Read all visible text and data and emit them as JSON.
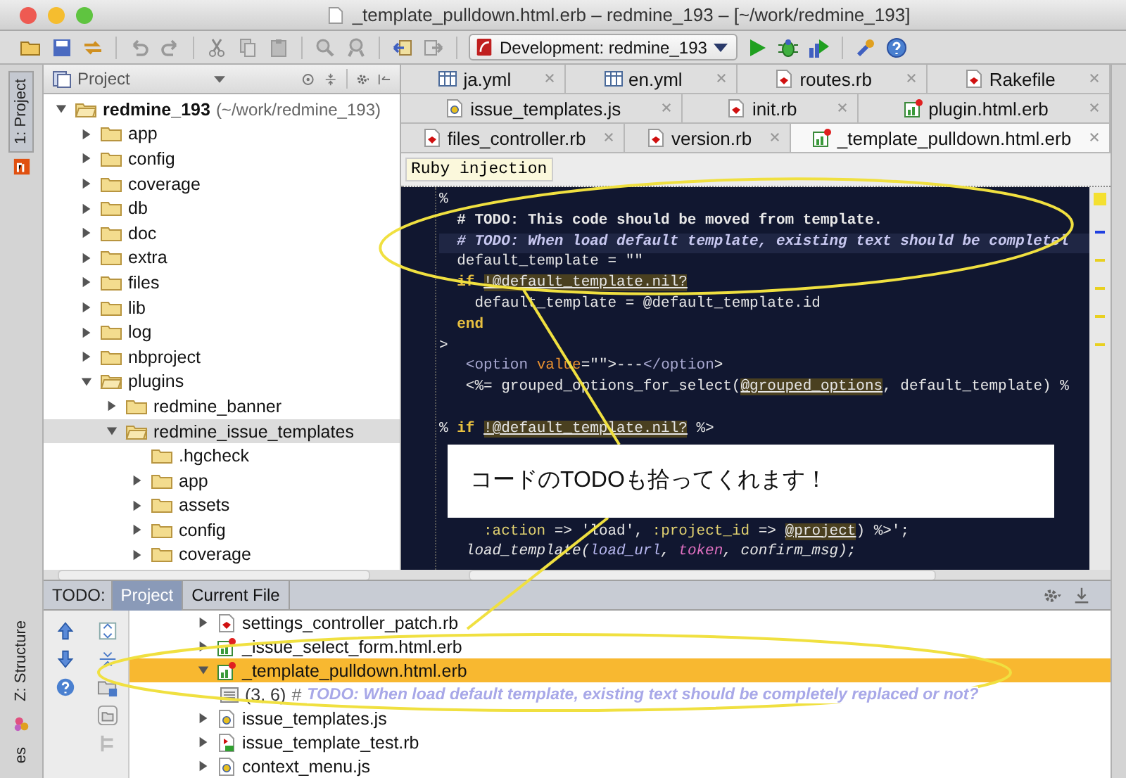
{
  "window": {
    "title": "_template_pulldown.html.erb – redmine_193 – [~/work/redmine_193]"
  },
  "toolbar": {
    "run_config": "Development: redmine_193"
  },
  "tool_strip": {
    "top_tabs": [
      {
        "label": "1: Project",
        "selected": true
      }
    ],
    "bottom_tabs": [
      {
        "label": "Z: Structure",
        "selected": false
      },
      {
        "label": "es",
        "selected": false
      }
    ]
  },
  "project_panel": {
    "title": "Project",
    "tree": [
      {
        "name": "redmine_193",
        "hint": "(~/work/redmine_193)",
        "expandable": true,
        "expanded": true,
        "selected": false,
        "children": [
          {
            "name": "app",
            "expandable": true,
            "expanded": false,
            "selected": false
          },
          {
            "name": "config",
            "expandable": true,
            "expanded": false,
            "selected": false
          },
          {
            "name": "coverage",
            "expandable": true,
            "expanded": false,
            "selected": false
          },
          {
            "name": "db",
            "expandable": true,
            "expanded": false,
            "selected": false
          },
          {
            "name": "doc",
            "expandable": true,
            "expanded": false,
            "selected": false
          },
          {
            "name": "extra",
            "expandable": true,
            "expanded": false,
            "selected": false
          },
          {
            "name": "files",
            "expandable": true,
            "expanded": false,
            "selected": false
          },
          {
            "name": "lib",
            "expandable": true,
            "expanded": false,
            "selected": false
          },
          {
            "name": "log",
            "expandable": true,
            "expanded": false,
            "selected": false
          },
          {
            "name": "nbproject",
            "expandable": true,
            "expanded": false,
            "selected": false
          },
          {
            "name": "plugins",
            "expandable": true,
            "expanded": true,
            "selected": false,
            "children": [
              {
                "name": "redmine_banner",
                "expandable": true,
                "expanded": false,
                "selected": false
              },
              {
                "name": "redmine_issue_templates",
                "expandable": true,
                "expanded": true,
                "selected": true,
                "children": [
                  {
                    "name": ".hgcheck",
                    "expandable": false,
                    "expanded": false,
                    "selected": false
                  },
                  {
                    "name": "app",
                    "expandable": true,
                    "expanded": false,
                    "selected": false
                  },
                  {
                    "name": "assets",
                    "expandable": true,
                    "expanded": false,
                    "selected": false
                  },
                  {
                    "name": "config",
                    "expandable": true,
                    "expanded": false,
                    "selected": false
                  },
                  {
                    "name": "coverage",
                    "expandable": true,
                    "expanded": false,
                    "selected": false
                  }
                ]
              }
            ]
          }
        ]
      }
    ]
  },
  "editor": {
    "tab_rows": [
      [
        {
          "label": "ja.yml",
          "kind": "yml",
          "selected": false
        },
        {
          "label": "en.yml",
          "kind": "yml",
          "selected": false
        },
        {
          "label": "routes.rb",
          "kind": "ruby",
          "selected": false
        },
        {
          "label": "Rakefile",
          "kind": "ruby",
          "selected": false
        }
      ],
      [
        {
          "label": "issue_templates.js",
          "kind": "js",
          "selected": false
        },
        {
          "label": "init.rb",
          "kind": "ruby",
          "selected": false
        },
        {
          "label": "plugin.html.erb",
          "kind": "erb",
          "selected": false
        }
      ],
      [
        {
          "label": "files_controller.rb",
          "kind": "ruby",
          "selected": false
        },
        {
          "label": "version.rb",
          "kind": "ruby",
          "selected": false
        },
        {
          "label": "_template_pulldown.html.erb",
          "kind": "erb",
          "selected": true
        }
      ]
    ],
    "breadcrumb": "Ruby injection",
    "blocks": [
      {
        "kind": "lines",
        "lines": [
          {
            "current": false,
            "tokens": [
              {
                "kind": "text",
                "text": "%"
              }
            ]
          },
          {
            "current": false,
            "tokens": [
              {
                "kind": "comment",
                "text": "  # TODO: This code should be moved from template."
              }
            ]
          },
          {
            "current": true,
            "tokens": [
              {
                "kind": "todo",
                "text": "  # TODO: When load default template, existing text should be completel"
              }
            ]
          },
          {
            "current": false,
            "tokens": [
              {
                "kind": "text",
                "text": "  default_template = \"\""
              }
            ]
          },
          {
            "current": false,
            "tokens": [
              {
                "kind": "keyword",
                "text": "  if "
              },
              {
                "kind": "ivar",
                "text": "!@default_template.nil?"
              }
            ]
          },
          {
            "current": false,
            "tokens": [
              {
                "kind": "text",
                "text": "    default_template = @default_template.id"
              }
            ]
          },
          {
            "current": false,
            "tokens": [
              {
                "kind": "keyword",
                "text": "  end"
              }
            ]
          },
          {
            "current": false,
            "tokens": [
              {
                "kind": "text",
                "text": ">"
              }
            ]
          },
          {
            "current": false,
            "tokens": [
              {
                "kind": "tag",
                "text": "   <option"
              },
              {
                "kind": "attr",
                "text": " value"
              },
              {
                "kind": "text",
                "text": "="
              },
              {
                "kind": "string",
                "text": "\"\""
              },
              {
                "kind": "text",
                "text": ">---"
              },
              {
                "kind": "tag",
                "text": "</option"
              },
              {
                "kind": "text",
                "text": ">"
              }
            ]
          },
          {
            "current": false,
            "tokens": [
              {
                "kind": "text",
                "text": "   <%= grouped_options_for_select("
              },
              {
                "kind": "ivar",
                "text": "@grouped_options"
              },
              {
                "kind": "text",
                "text": ", default_template) %"
              }
            ]
          }
        ]
      },
      {
        "kind": "gap"
      },
      {
        "kind": "lines",
        "lines": [
          {
            "current": false,
            "tokens": [
              {
                "kind": "text",
                "text": "% "
              },
              {
                "kind": "keyword",
                "text": "if "
              },
              {
                "kind": "ivar",
                "text": "!@default_template.nil?"
              },
              {
                "kind": "text",
                "text": " %>"
              }
            ]
          }
        ]
      },
      {
        "kind": "callout",
        "text": "コードのTODOも拾ってくれます！"
      },
      {
        "kind": "lines",
        "lines": [
          {
            "current": false,
            "tokens": [
              {
                "kind": "symbol",
                "text": "     :action"
              },
              {
                "kind": "text",
                "text": " => "
              },
              {
                "kind": "string",
                "text": "'load'"
              },
              {
                "kind": "text",
                "text": ", "
              },
              {
                "kind": "symbol",
                "text": ":project_id"
              },
              {
                "kind": "text",
                "text": " => "
              },
              {
                "kind": "ivar",
                "text": "@project"
              },
              {
                "kind": "text",
                "text": ") %>';"
              }
            ]
          },
          {
            "current": false,
            "tokens": [
              {
                "kind": "local",
                "text": "   load_template("
              },
              {
                "kind": "param",
                "text": "load_url"
              },
              {
                "kind": "local",
                "text": ", "
              },
              {
                "kind": "pink",
                "text": "token"
              },
              {
                "kind": "local",
                "text": ", confirm_msg);"
              }
            ]
          }
        ]
      }
    ]
  },
  "todo_panel": {
    "label": "TODO:",
    "tabs": [
      {
        "label": "Project",
        "selected": true
      },
      {
        "label": "Current File",
        "selected": false
      }
    ],
    "tree": [
      {
        "kind": "ruby",
        "name": "settings_controller_patch.rb",
        "expanded": false,
        "selected": false
      },
      {
        "kind": "erb",
        "name": "_issue_select_form.html.erb",
        "expanded": false,
        "selected": false
      },
      {
        "kind": "erb",
        "name": "_template_pulldown.html.erb",
        "expanded": true,
        "selected": true,
        "children": [
          {
            "kind": "todo",
            "position": "(3, 6)",
            "marker": "#",
            "text": "TODO: When load default template, existing text should be completely replaced or not?",
            "expanded": false,
            "selected": false
          }
        ]
      },
      {
        "kind": "js",
        "name": "issue_templates.js",
        "expanded": false,
        "selected": false
      },
      {
        "kind": "test",
        "name": "issue_template_test.rb",
        "expanded": false,
        "selected": false
      },
      {
        "kind": "js",
        "name": "context_menu.js",
        "expanded": false,
        "selected": false
      }
    ]
  }
}
